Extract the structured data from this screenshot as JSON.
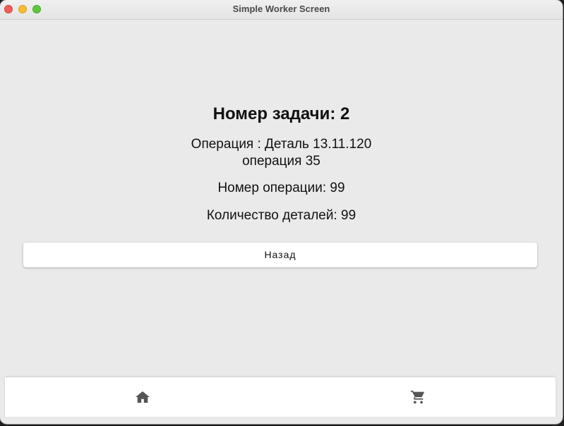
{
  "window": {
    "title": "Simple Worker Screen"
  },
  "task": {
    "title": "Номер задачи: 2",
    "operation_line1": "Операция : Деталь 13.11.120",
    "operation_line2": "операция 35",
    "operation_number": "Номер операции: 99",
    "part_count": "Количество деталей: 99"
  },
  "actions": {
    "back_label": "Назад"
  },
  "bottom_nav": {
    "items": [
      {
        "icon": "home-icon"
      },
      {
        "icon": "cart-icon"
      }
    ]
  },
  "colors": {
    "background": "#eaeaea",
    "surface": "#ffffff",
    "icon": "#555555",
    "text": "#111111"
  }
}
